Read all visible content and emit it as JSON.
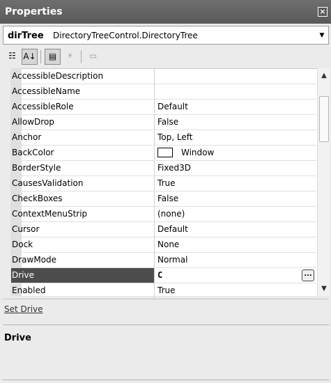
{
  "window": {
    "title": "Properties",
    "close_glyph": "×"
  },
  "object_selector": {
    "name": "dirTree",
    "type": "DirectoryTreeControl.DirectoryTree",
    "arrow_glyph": "▼"
  },
  "toolbar": {
    "buttons": [
      {
        "icon": "categorized-icon",
        "glyph": "☷"
      },
      {
        "icon": "alphabetical-icon",
        "glyph": "A↓"
      },
      {
        "icon": "properties-icon",
        "glyph": "▤"
      },
      {
        "icon": "events-icon",
        "glyph": "⚡"
      },
      {
        "icon": "property-pages-icon",
        "glyph": "▭"
      }
    ]
  },
  "properties": [
    {
      "name": "AccessibleDescription",
      "value": ""
    },
    {
      "name": "AccessibleName",
      "value": ""
    },
    {
      "name": "AccessibleRole",
      "value": "Default"
    },
    {
      "name": "AllowDrop",
      "value": "False"
    },
    {
      "name": "Anchor",
      "value": "Top, Left"
    },
    {
      "name": "BackColor",
      "value": "Window"
    },
    {
      "name": "BorderStyle",
      "value": "Fixed3D"
    },
    {
      "name": "CausesValidation",
      "value": "True"
    },
    {
      "name": "CheckBoxes",
      "value": "False"
    },
    {
      "name": "ContextMenuStrip",
      "value": "(none)"
    },
    {
      "name": "Cursor",
      "value": "Default"
    },
    {
      "name": "Dock",
      "value": "None"
    },
    {
      "name": "DrawMode",
      "value": "Normal"
    },
    {
      "name": "Drive",
      "value": "C"
    },
    {
      "name": "Enabled",
      "value": "True"
    }
  ],
  "selected_property": "Drive",
  "ellipsis_label": "...",
  "scrollbar": {
    "up_glyph": "▲",
    "down_glyph": "▼"
  },
  "commands": {
    "set_drive": "Set Drive"
  },
  "description": {
    "title": "Drive"
  }
}
